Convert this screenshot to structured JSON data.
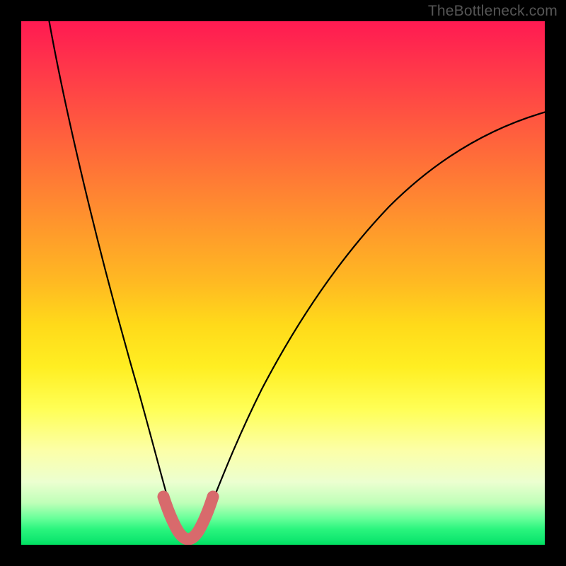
{
  "watermark": "TheBottleneck.com",
  "chart_data": {
    "type": "line",
    "title": "",
    "xlabel": "",
    "ylabel": "",
    "xlim": [
      0,
      100
    ],
    "ylim": [
      0,
      100
    ],
    "grid": false,
    "legend": false,
    "background": "rainbow-gradient (red top to green bottom)",
    "series": [
      {
        "name": "bottleneck-curve",
        "color": "#000000",
        "x": [
          0,
          5,
          10,
          15,
          20,
          25,
          28,
          30,
          32,
          34,
          36,
          40,
          45,
          50,
          55,
          60,
          65,
          70,
          75,
          80,
          85,
          90,
          95,
          100
        ],
        "y": [
          100,
          90,
          78,
          64,
          48,
          25,
          10,
          2,
          0,
          2,
          8,
          18,
          30,
          40,
          48,
          55,
          61,
          66,
          70,
          73,
          76,
          78,
          80,
          81
        ],
        "note": "V-shaped curve. Left branch falls steeply from top-left to a minimum near x≈31, then right branch rises with decreasing slope toward upper-right. Values are percentages of plot height (100=top, 0=bottom)."
      },
      {
        "name": "minimum-highlight",
        "color": "#d86a6c",
        "x": [
          26,
          28,
          30,
          32,
          34,
          36
        ],
        "y": [
          10,
          3,
          0,
          0,
          3,
          10
        ],
        "note": "Thick salmon U-shaped stroke overlaid at the bottom of the V."
      }
    ]
  }
}
